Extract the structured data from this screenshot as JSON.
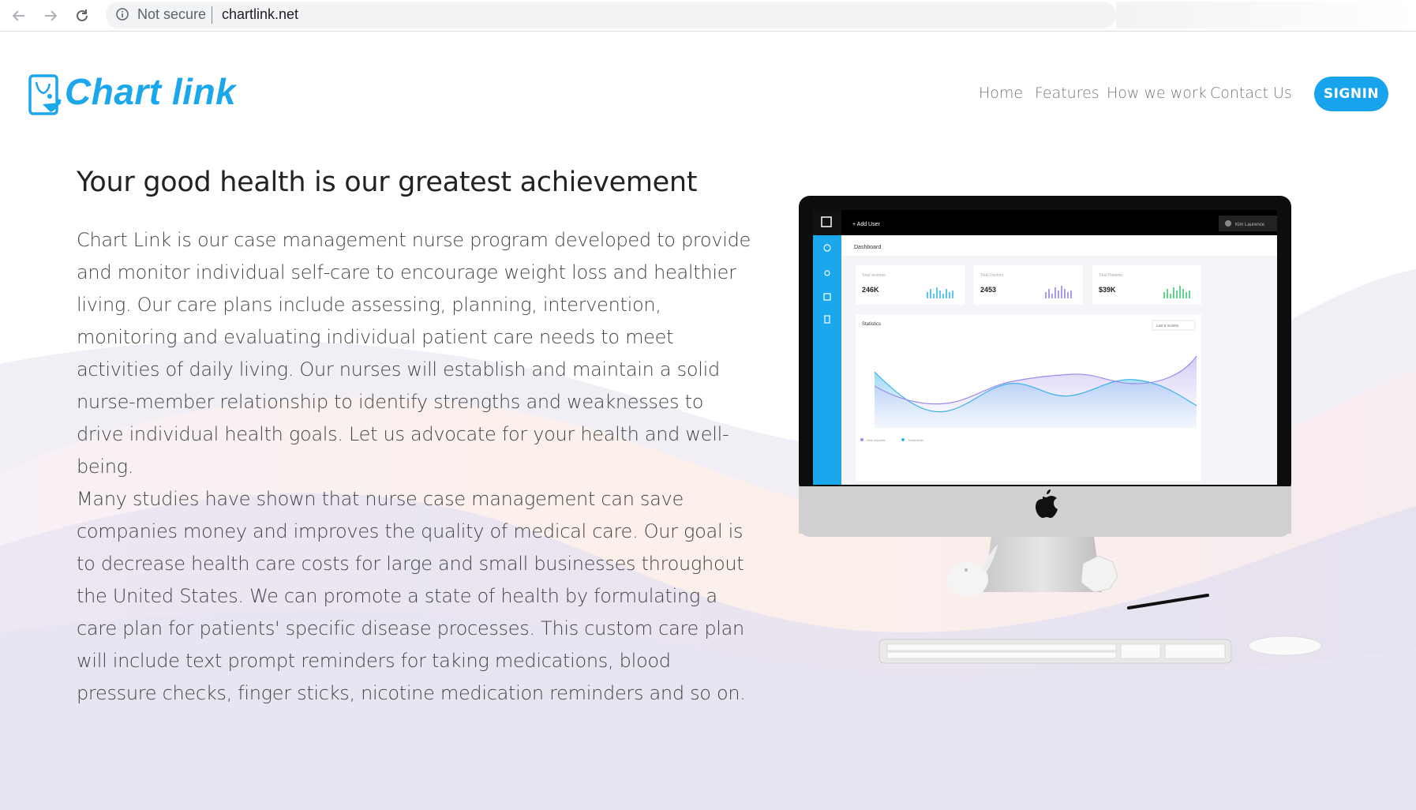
{
  "browser": {
    "security_label": "Not secure",
    "url": "chartlink.net"
  },
  "header": {
    "logo_text": "Chart link",
    "nav": [
      {
        "label": "Home"
      },
      {
        "label": "Features"
      },
      {
        "label": "How we work"
      },
      {
        "label": "Contact Us"
      }
    ],
    "signin_label": "SIGNIN"
  },
  "hero": {
    "title": "Your good health is our greatest achievement",
    "paragraph1": "Chart Link is our case management nurse program developed to provide and monitor individual self-care to encourage weight loss and healthier living. Our care plans include assessing, planning, intervention, monitoring and evaluating individual patient care needs to meet activities of daily living. Our nurses will establish and maintain a solid nurse-member relationship to identify strengths and weaknesses to drive individual health goals. Let us advocate for your health and well-being.",
    "paragraph2": "Many studies have shown that nurse case management can save companies money and improves the quality of medical care. Our goal is to decrease health care costs for large and small businesses throughout the United States. We can promote a state of health by formulating a care plan for patients' specific disease processes. This custom care plan will include text prompt reminders for taking medications, blood pressure checks, finger sticks, nicotine medication reminders and so on."
  },
  "dashboard_mock": {
    "add_user": "+ Add User",
    "user_name": "Kim Laurence",
    "page_title": "Dashboard",
    "cards": [
      {
        "label": "Total revenue",
        "value": "246K"
      },
      {
        "label": "Total Doctors",
        "value": "2453"
      },
      {
        "label": "Total Patients",
        "value": "$39K"
      }
    ],
    "stats_title": "Statistics",
    "range_select": "Last 6 months",
    "legend": [
      "New inquiries",
      "Treatments"
    ]
  },
  "colors": {
    "brand": "#18a4ec",
    "nav_text": "#777777"
  }
}
